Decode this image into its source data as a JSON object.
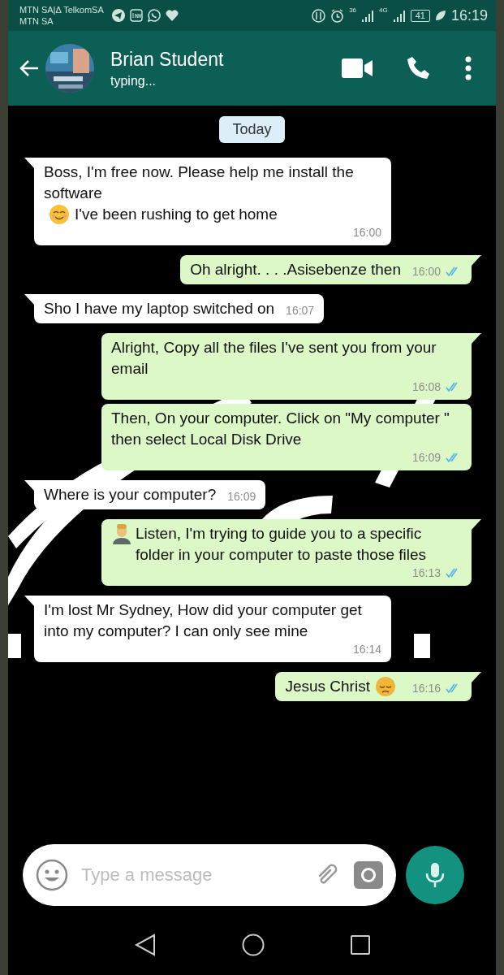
{
  "status_bar": {
    "carriers": [
      "MTN SA|Δ TelkomSA",
      "MTN SA"
    ],
    "network_1": "36",
    "network_2": "4G",
    "battery": "41",
    "time": "16:19"
  },
  "header": {
    "name": "Brian Student",
    "status": "typing..."
  },
  "date_chip": "Today",
  "messages": [
    {
      "kind": "incoming",
      "parts": [
        {
          "kind": "text",
          "text": "Boss, I'm free now. Please help me install the software"
        },
        {
          "kind": "smile"
        },
        {
          "kind": "text",
          "text": "I've been rushing to get home"
        }
      ],
      "time": "16:00"
    },
    {
      "kind": "outgoing",
      "parts": [
        {
          "kind": "text",
          "text": "Oh alright. . . .Asisebenze then"
        }
      ],
      "time": "16:00",
      "read": true
    },
    {
      "kind": "incoming",
      "parts": [
        {
          "kind": "text",
          "text": "Sho I have my laptop switched on"
        }
      ],
      "time": "16:07"
    },
    {
      "kind": "outgoing",
      "parts": [
        {
          "kind": "text",
          "text": "Alright, Copy all the files I've sent you from your email"
        }
      ],
      "time": "16:08",
      "read": true
    },
    {
      "kind": "outgoing",
      "parts": [
        {
          "kind": "text",
          "text": "Then, On your computer. Click on \"My computer \" then select Local Disk Drive"
        }
      ],
      "time": "16:09",
      "read": true
    },
    {
      "kind": "incoming",
      "parts": [
        {
          "kind": "text",
          "text": "Where is your computer?"
        }
      ],
      "time": "16:09"
    },
    {
      "kind": "outgoing",
      "parts": [
        {
          "kind": "person"
        },
        {
          "kind": "text",
          "text": "Listen, I'm trying to guide you to a specific folder in your computer to paste those files"
        }
      ],
      "time": "16:13",
      "read": true
    },
    {
      "kind": "incoming",
      "parts": [
        {
          "kind": "text",
          "text": "I'm lost Mr Sydney, How did your computer get into my computer? I can only see mine"
        }
      ],
      "time": "16:14"
    },
    {
      "kind": "outgoing",
      "parts": [
        {
          "kind": "text",
          "text": "Jesus Christ"
        },
        {
          "kind": "pensive"
        }
      ],
      "time": "16:16",
      "read": true
    }
  ],
  "composer": {
    "placeholder": "Type a message"
  }
}
